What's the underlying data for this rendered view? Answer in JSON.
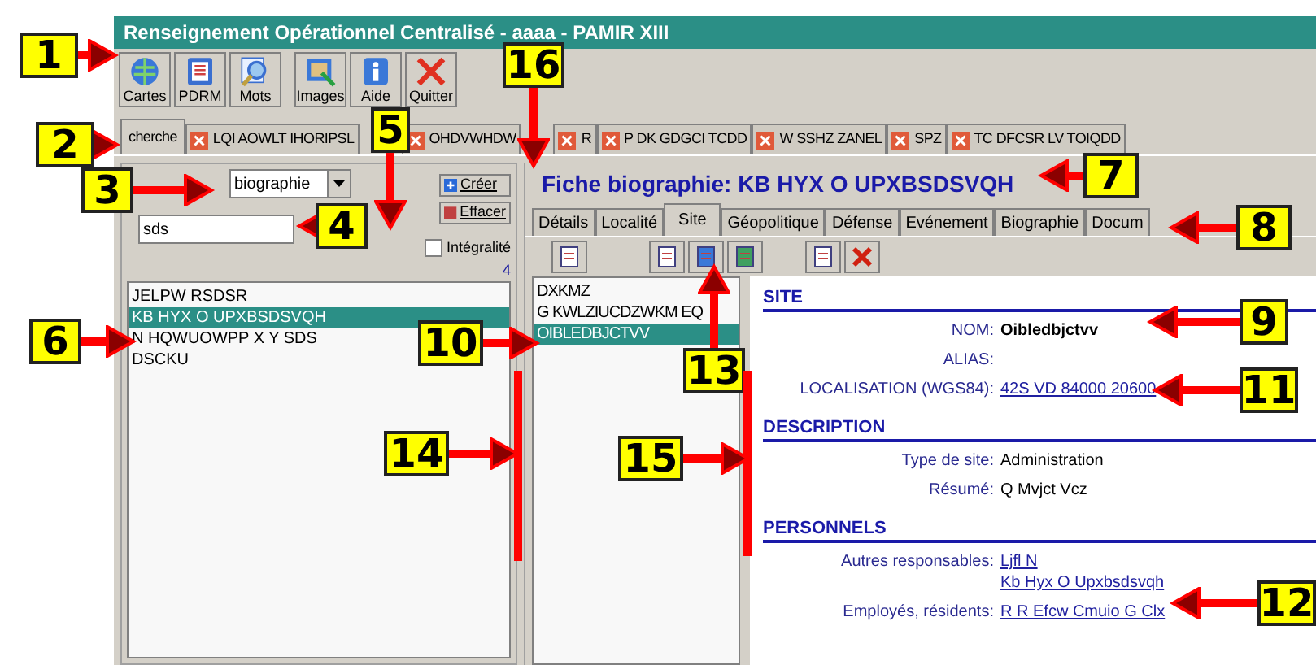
{
  "window": {
    "title": "Renseignement Opérationnel Centralisé  -  aaaa  -  PAMIR XIII"
  },
  "toolbar": [
    {
      "label": "Cartes",
      "kind": "globe"
    },
    {
      "label": "PDRM",
      "kind": "list"
    },
    {
      "label": "Mots",
      "kind": "magnifier"
    },
    {
      "label": "Images",
      "kind": "image"
    },
    {
      "label": "Aide",
      "kind": "info"
    },
    {
      "label": "Quitter",
      "kind": "close"
    }
  ],
  "tabs": [
    {
      "label": "cherche",
      "selected": true,
      "closable": false
    },
    {
      "label": "LQI AOWLT IHORIPSL",
      "selected": false,
      "closable": true
    },
    {
      "label": "OHDVWHDW",
      "selected": false,
      "closable": true
    },
    {
      "label": "R",
      "selected": false,
      "closable": true
    },
    {
      "label": "P DK GDGCI TCDD",
      "selected": false,
      "closable": true
    },
    {
      "label": "W SSHZ ZANEL",
      "selected": false,
      "closable": true
    },
    {
      "label": "SPZ",
      "selected": false,
      "closable": true
    },
    {
      "label": "TC DFCSR LV TOIQDD",
      "selected": false,
      "closable": true
    }
  ],
  "search": {
    "type_value": "biographie",
    "buttons": [
      {
        "label": "Créer",
        "kind": "create"
      },
      {
        "label": "Effacer",
        "kind": "clear"
      }
    ],
    "query": "sds",
    "full_match": {
      "label": "Intégralité",
      "checked": false
    },
    "count": "4",
    "results": [
      {
        "label": "JELPW RSDSR",
        "selected": false
      },
      {
        "label": "KB HYX O UPXBSDSVQH",
        "selected": true
      },
      {
        "label": "N HQWUOWPP X Y SDS",
        "selected": false
      },
      {
        "label": "DSCKU",
        "selected": false
      }
    ]
  },
  "record": {
    "title": "Fiche biographie: KB HYX O UPXBSDSVQH",
    "tabs": [
      {
        "label": "Détails",
        "selected": false
      },
      {
        "label": "Localité",
        "selected": false
      },
      {
        "label": "Site",
        "selected": true
      },
      {
        "label": "Géopolitique",
        "selected": false
      },
      {
        "label": "Défense",
        "selected": false
      },
      {
        "label": "Evénement",
        "selected": false
      },
      {
        "label": "Biographie",
        "selected": false
      },
      {
        "label": "Docum",
        "selected": false
      }
    ],
    "sites": [
      {
        "label": "DXKMZ",
        "selected": false
      },
      {
        "label": "G KWLZIUCDZWKM EQ",
        "selected": false
      },
      {
        "label": "OIBLEDBJCTVV",
        "selected": true
      }
    ],
    "sections": [
      {
        "heading": "SITE",
        "fields": [
          {
            "label": "NOM:",
            "values": [
              {
                "text": "Oibledbjctvv",
                "kind": "bold"
              }
            ]
          },
          {
            "label": "ALIAS:"
          },
          {
            "label": "LOCALISATION (WGS84):",
            "values": [
              {
                "text": "42S VD 84000 20600",
                "kind": "link"
              }
            ]
          }
        ]
      },
      {
        "heading": "DESCRIPTION",
        "fields": [
          {
            "label": "Type de site:",
            "values": [
              {
                "text": "Administration",
                "kind": "plain"
              }
            ]
          },
          {
            "label": "Résumé:",
            "values": [
              {
                "text": "Q Mvjct Vcz",
                "kind": "plain"
              }
            ]
          }
        ]
      },
      {
        "heading": "PERSONNELS",
        "fields": [
          {
            "label": "Autres responsables:",
            "values": [
              {
                "text": "Ljfl N",
                "kind": "link"
              },
              {
                "text": "Kb Hyx O Upxbsdsvqh",
                "kind": "link"
              }
            ]
          },
          {
            "label": "Employés, résidents:",
            "values": [
              {
                "text": "R R Efcw Cmuio G Clx",
                "kind": "link"
              }
            ]
          }
        ]
      }
    ]
  },
  "callouts": [
    {
      "number": "1"
    },
    {
      "number": "2"
    },
    {
      "number": "3"
    },
    {
      "number": "4"
    },
    {
      "number": "5"
    },
    {
      "number": "6"
    },
    {
      "number": "7"
    },
    {
      "number": "8"
    },
    {
      "number": "9"
    },
    {
      "number": "10"
    },
    {
      "number": "11"
    },
    {
      "number": "12"
    },
    {
      "number": "13"
    },
    {
      "number": "14"
    },
    {
      "number": "15"
    },
    {
      "number": "16"
    }
  ]
}
